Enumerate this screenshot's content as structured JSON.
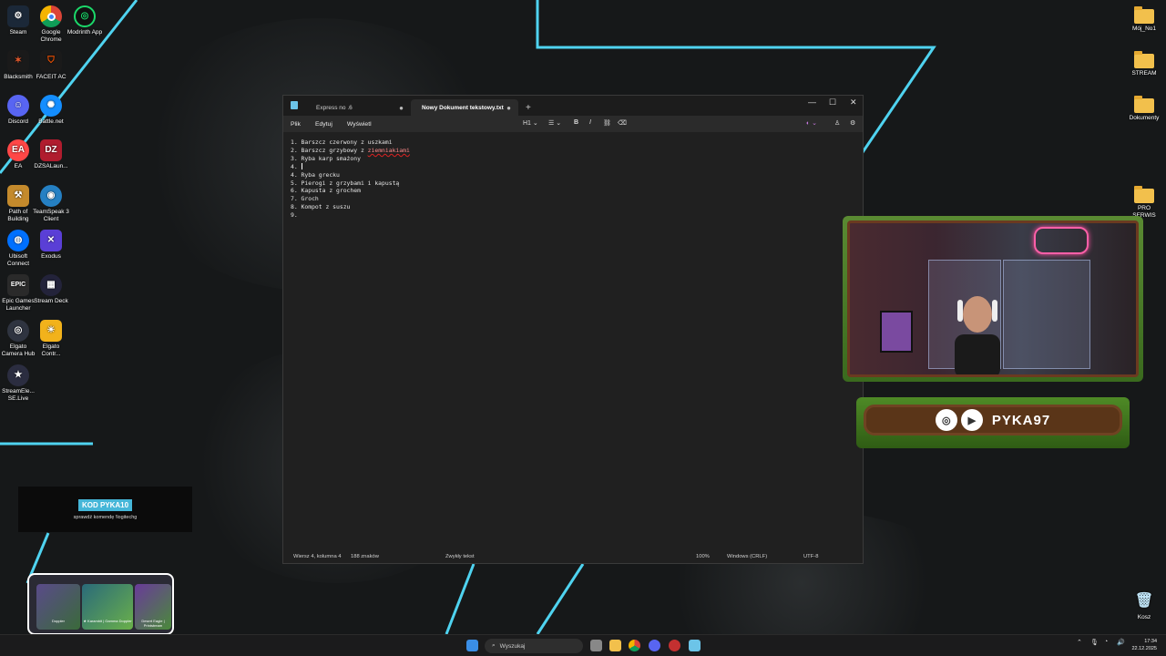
{
  "desktop_left": [
    {
      "label": "Steam",
      "icon": "steam-icon",
      "color": "#1b2838"
    },
    {
      "label": "Google Chrome",
      "icon": "chrome-icon",
      "color": "#db4437"
    },
    {
      "label": "Modrinth App",
      "icon": "modrinth-icon",
      "color": "#1bd96a"
    },
    {
      "label": "Blacksmith",
      "icon": "blacksmith-icon",
      "color": "#e0572b"
    },
    {
      "label": "FACEIT AC",
      "icon": "faceit-icon",
      "color": "#ff5500"
    },
    {
      "label": "Discord",
      "icon": "discord-icon",
      "color": "#5865f2"
    },
    {
      "label": "Battle.net",
      "icon": "battlenet-icon",
      "color": "#148eff"
    },
    {
      "label": "EA",
      "icon": "ea-icon",
      "color": "#ff4747"
    },
    {
      "label": "DZSALaun...",
      "icon": "dzsa-icon",
      "color": "#b01c2e"
    },
    {
      "label": "Path of Building",
      "icon": "pob-icon",
      "color": "#c48a2c"
    },
    {
      "label": "TeamSpeak 3 Client",
      "icon": "teamspeak-icon",
      "color": "#2580c3"
    },
    {
      "label": "Ubisoft Connect",
      "icon": "ubisoft-icon",
      "color": "#0070ff"
    },
    {
      "label": "Exodus",
      "icon": "exodus-icon",
      "color": "#5a3fd6"
    },
    {
      "label": "Epic Games Launcher",
      "icon": "epic-icon",
      "color": "#2a2a2a"
    },
    {
      "label": "Stream Deck",
      "icon": "streamdeck-icon",
      "color": "#23233a"
    },
    {
      "label": "Elgato Camera Hub",
      "icon": "camerahub-icon",
      "color": "#2f3440"
    },
    {
      "label": "Elgato Contr...",
      "icon": "elgato-control-icon",
      "color": "#f2b21b"
    },
    {
      "label": "StreamEle... SE.Live",
      "icon": "streamelements-icon",
      "color": "#2b2d40"
    }
  ],
  "desktop_right": [
    {
      "label": "Mój_No1",
      "icon": "folder-icon"
    },
    {
      "label": "STREAM",
      "icon": "folder-icon"
    },
    {
      "label": "Dokumenty",
      "icon": "folder-icon"
    },
    {
      "label": "PRO SERWIS",
      "icon": "folder-icon"
    },
    {
      "label": "Kosz",
      "icon": "recycle-bin-icon"
    }
  ],
  "notepad": {
    "tabs": [
      {
        "label": "Express no .6",
        "active": false
      },
      {
        "label": "Nowy Dokument tekstowy.txt",
        "active": true
      }
    ],
    "menu": {
      "file": "Plik",
      "edit": "Edytuj",
      "view": "Wyświetl"
    },
    "toolbar": {
      "heading": "H1"
    },
    "lines": [
      "1. Barszcz czerwony z uszkami",
      "2. Barszcz grzybowy z ",
      "3. Ryba karp smażony",
      "4. ",
      "4. Ryba grecku",
      "5. Pierogi z grzybami i kapustą",
      "6. Kapusta z grochem",
      "7. Groch",
      "8. Kompot z suszu",
      "9."
    ],
    "misspelled_word": "ziemniakiami",
    "status": {
      "position": "Wiersz 4, kolumna 4",
      "chars": "188 znaków",
      "format": "Zwykły tekst",
      "zoom": "100%",
      "line_ending": "Windows (CRLF)",
      "encoding": "UTF-8"
    }
  },
  "stream": {
    "handle": "PYKA97",
    "promo_code": "KOD PYKA10",
    "promo_hint": "sprawdź komendę !logitechg",
    "skins": [
      {
        "name": "Doppler"
      },
      {
        "name": "★ Karambit | Gamma Doppler"
      },
      {
        "name": "Desert Eagle | Printstream"
      }
    ]
  },
  "taskbar": {
    "search_placeholder": "Wyszukaj",
    "time": "17:34",
    "date": "22.12.2025"
  },
  "colors": {
    "accent_cyan": "#4fd3f0",
    "grass": "#4e8a26",
    "wood": "#5a3518"
  }
}
